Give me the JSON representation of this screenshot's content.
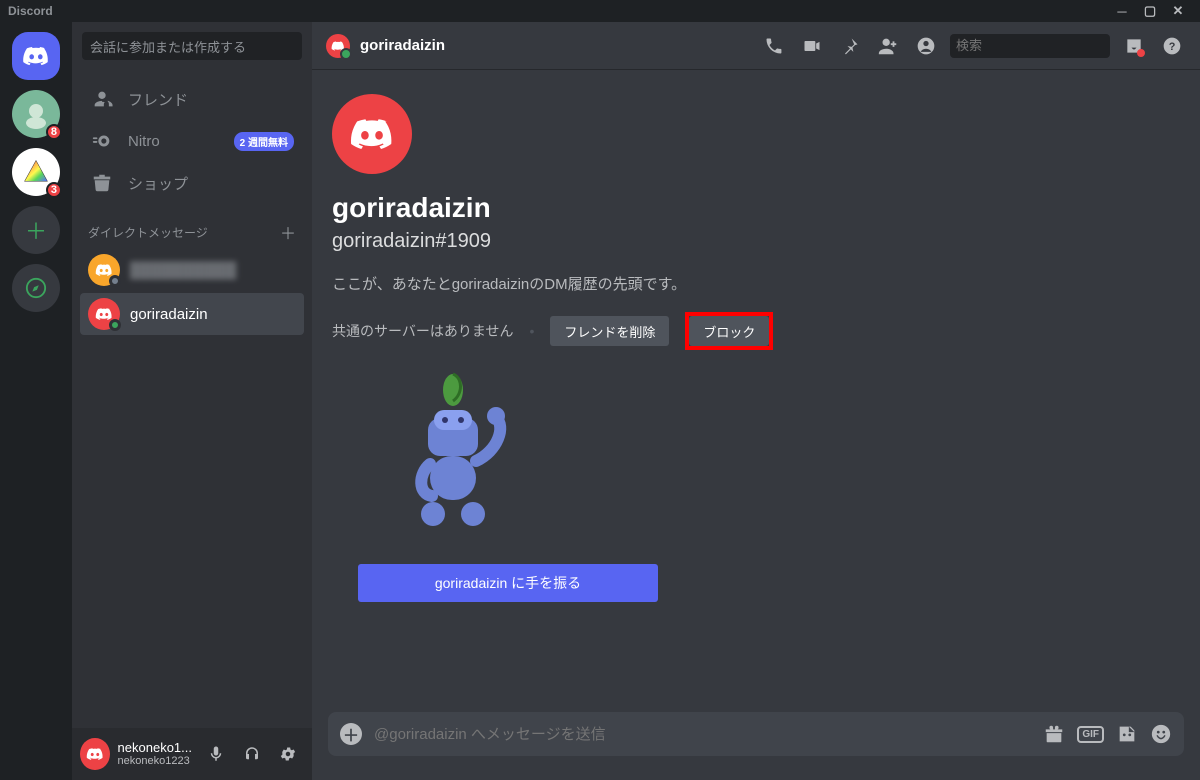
{
  "window": {
    "title": "Discord"
  },
  "guilds": {
    "server1_badge": "8",
    "server2_badge": "3"
  },
  "sidebar": {
    "search_placeholder": "会話に参加または作成する",
    "nav": {
      "friends": "フレンド",
      "nitro": "Nitro",
      "nitro_badge": "2 週間無料",
      "shop": "ショップ"
    },
    "dm_header": "ダイレクトメッセージ",
    "dms": [
      {
        "name": "██████████"
      },
      {
        "name": "goriradaizin"
      }
    ]
  },
  "user_panel": {
    "username": "nekoneko1...",
    "tag": "nekoneko1223"
  },
  "header": {
    "title": "goriradaizin",
    "search_placeholder": "検索"
  },
  "content": {
    "username": "goriradaizin",
    "usertag": "goriradaizin#1909",
    "welcome": "ここが、あなたとgoriradaizinのDM履歴の先頭です。",
    "no_common_servers": "共通のサーバーはありません",
    "remove_friend_btn": "フレンドを削除",
    "block_btn": "ブロック",
    "wave_btn": "goriradaizin に手を振る"
  },
  "composer": {
    "placeholder": "@goriradaizin へメッセージを送信"
  }
}
